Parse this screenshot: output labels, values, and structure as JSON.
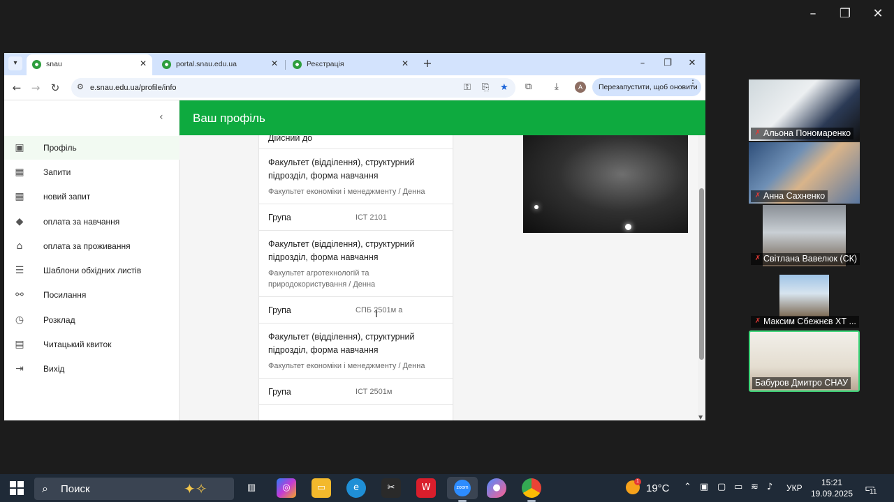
{
  "browser": {
    "tabs": [
      {
        "title": "snau"
      },
      {
        "title": "portal.snau.edu.ua"
      },
      {
        "title": "Реєстрація"
      }
    ],
    "url": "e.snau.edu.ua/profile/info",
    "update_button": "Перезапустити, щоб оновити",
    "avatar_letter": "A"
  },
  "sidebar": {
    "items": [
      {
        "label": "Профіль",
        "icon": "profile-icon"
      },
      {
        "label": "Запити",
        "icon": "dashboard-icon"
      },
      {
        "label": "новий запит",
        "icon": "dashboard-icon"
      },
      {
        "label": "оплата за навчання",
        "icon": "graduation-cap-icon"
      },
      {
        "label": "оплата за проживання",
        "icon": "bank-icon"
      },
      {
        "label": "Шаблони обхідних листів",
        "icon": "list-icon"
      },
      {
        "label": "Посилання",
        "icon": "link-icon"
      },
      {
        "label": "Розклад",
        "icon": "clock-icon"
      },
      {
        "label": "Читацький квиток",
        "icon": "library-icon"
      },
      {
        "label": "Вихід",
        "icon": "logout-icon"
      }
    ]
  },
  "header": {
    "title": "Ваш профіль"
  },
  "profile": {
    "valid_until_label": "Дійсний до",
    "rows": [
      {
        "key": "Факультет (відділення), структурний підрозділ, форма навчання",
        "value": "Факультет економіки і менеджменту / Денна"
      },
      {
        "key": "Група",
        "value": "ІСТ 2101"
      },
      {
        "key": "Факультет (відділення), структурний підрозділ, форма навчання",
        "value": "Факультет агротехнологій та природокористування / Денна"
      },
      {
        "key": "Група",
        "value": "СПБ 2501м а"
      },
      {
        "key": "Факультет (відділення), структурний підрозділ, форма навчання",
        "value": "Факультет економіки і менеджменту / Денна"
      },
      {
        "key": "Група",
        "value": "ІСТ 2501м"
      }
    ]
  },
  "participants": [
    {
      "name": "Альона Пономаренко",
      "muted": true
    },
    {
      "name": "Анна Сахненко",
      "muted": true
    },
    {
      "name": "Світлана Вавелюк (СК)",
      "muted": true
    },
    {
      "name": "Максим Сбежнєв ХТ ...",
      "muted": true
    },
    {
      "name": "Бабуров Дмитро СНАУ",
      "muted": false
    }
  ],
  "taskbar": {
    "search_placeholder": "Поиск",
    "weather": "19°C",
    "weather_badge": "1",
    "language": "УКР",
    "time": "15:21",
    "date": "19.09.2025",
    "notifications": "11",
    "zoom_label": "zoom"
  },
  "colors": {
    "accent_green": "#0eaa3f",
    "tab_strip": "#d3e3fd",
    "speaking_border": "#3ed67a"
  }
}
